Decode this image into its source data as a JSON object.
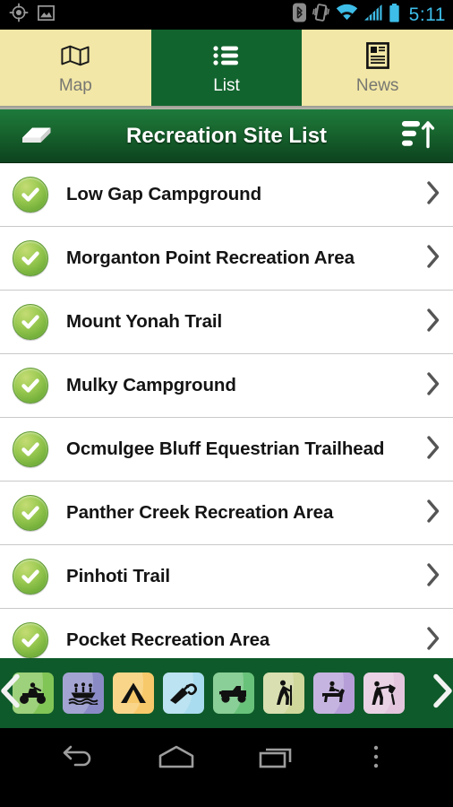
{
  "status_bar": {
    "time": "5:11",
    "time_color": "#3dbde8",
    "left_icons": [
      "gps-location-icon",
      "gallery-image-icon"
    ],
    "right_icons": [
      "bluetooth-icon",
      "vibrate-icon",
      "wifi-icon",
      "cellular-signal-icon",
      "battery-icon"
    ]
  },
  "tabs": [
    {
      "label": "Map",
      "icon": "map-icon",
      "selected": false
    },
    {
      "label": "List",
      "icon": "list-icon",
      "selected": true
    },
    {
      "label": "News",
      "icon": "news-icon",
      "selected": false
    }
  ],
  "action_bar": {
    "title": "Recreation Site List",
    "left_icon": "eraser-clear-icon",
    "right_icon": "sort-ascending-icon"
  },
  "list": {
    "rows": [
      {
        "label": "Low Gap Campground",
        "status_icon": "green-check-icon",
        "chevron": "chevron-right-icon"
      },
      {
        "label": "Morganton Point Recreation Area",
        "status_icon": "green-check-icon",
        "chevron": "chevron-right-icon"
      },
      {
        "label": "Mount Yonah Trail",
        "status_icon": "green-check-icon",
        "chevron": "chevron-right-icon"
      },
      {
        "label": "Mulky Campground",
        "status_icon": "green-check-icon",
        "chevron": "chevron-right-icon"
      },
      {
        "label": "Ocmulgee Bluff Equestrian Trailhead",
        "status_icon": "green-check-icon",
        "chevron": "chevron-right-icon"
      },
      {
        "label": "Panther Creek Recreation Area",
        "status_icon": "green-check-icon",
        "chevron": "chevron-right-icon"
      },
      {
        "label": "Pinhoti Trail",
        "status_icon": "green-check-icon",
        "chevron": "chevron-right-icon"
      },
      {
        "label": "Pocket Recreation Area",
        "status_icon": "green-check-icon",
        "chevron": "chevron-right-icon"
      }
    ]
  },
  "activity_filter": {
    "scroll_left_icon": "chevron-left-icon",
    "scroll_right_icon": "chevron-right-icon",
    "items": [
      {
        "name": "atv-riding-icon",
        "color": "#82c557"
      },
      {
        "name": "boating-icon",
        "color": "#8a8bc6"
      },
      {
        "name": "camping-tent-icon",
        "color": "#f8c96a"
      },
      {
        "name": "fishing-icon",
        "color": "#a9dcee"
      },
      {
        "name": "off-highway-vehicle-icon",
        "color": "#69c27a"
      },
      {
        "name": "hiking-icon",
        "color": "#cfd79a"
      },
      {
        "name": "horseback-riding-icon",
        "color": "#b69fd8"
      },
      {
        "name": "hunting-icon",
        "color": "#e3c6dd"
      }
    ]
  },
  "nav_bar": {
    "buttons": [
      {
        "name": "back-button",
        "icon": "back-arrow-icon"
      },
      {
        "name": "home-button",
        "icon": "home-icon"
      },
      {
        "name": "recents-button",
        "icon": "recents-icon"
      },
      {
        "name": "overflow-button",
        "icon": "overflow-menu-icon"
      }
    ]
  },
  "colors": {
    "brand_green": "#12642e",
    "tab_cream": "#f2e7a6",
    "accent_blue": "#3dbde8",
    "badge_green": "#77b23c"
  }
}
